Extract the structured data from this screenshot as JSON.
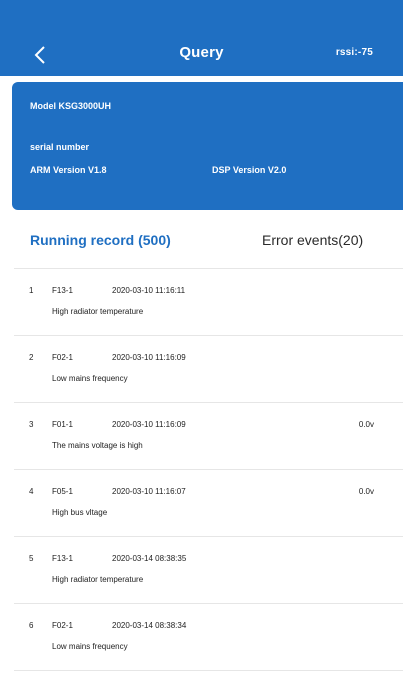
{
  "header": {
    "back_icon": "chevron-left-icon",
    "title": "Query",
    "rssi": "rssi:-75",
    "background_color": "#1f6fc2"
  },
  "device": {
    "model": "Model KSG3000UH",
    "serial_label": "serial number",
    "arm_version": "ARM Version V1.8",
    "dsp_version": "DSP Version V2.0"
  },
  "tabs": {
    "running": "Running record (500)",
    "errors": "Error events(20)",
    "active": "running",
    "active_color": "#1f6fc2"
  },
  "records": [
    {
      "index": "1",
      "code": "F13-1",
      "time": "2020-03-10 11:16:11",
      "value": "",
      "description": "High radiator temperature"
    },
    {
      "index": "2",
      "code": "F02-1",
      "time": "2020-03-10 11:16:09",
      "value": "",
      "description": "Low mains frequency"
    },
    {
      "index": "3",
      "code": "F01-1",
      "time": "2020-03-10 11:16:09",
      "value": "0.0v",
      "description": "The mains voltage is high"
    },
    {
      "index": "4",
      "code": "F05-1",
      "time": "2020-03-10 11:16:07",
      "value": "0.0v",
      "description": "High bus vltage"
    },
    {
      "index": "5",
      "code": "F13-1",
      "time": "2020-03-14 08:38:35",
      "value": "",
      "description": "High radiator temperature"
    },
    {
      "index": "6",
      "code": "F02-1",
      "time": "2020-03-14 08:38:34",
      "value": "",
      "description": "Low mains frequency"
    }
  ]
}
